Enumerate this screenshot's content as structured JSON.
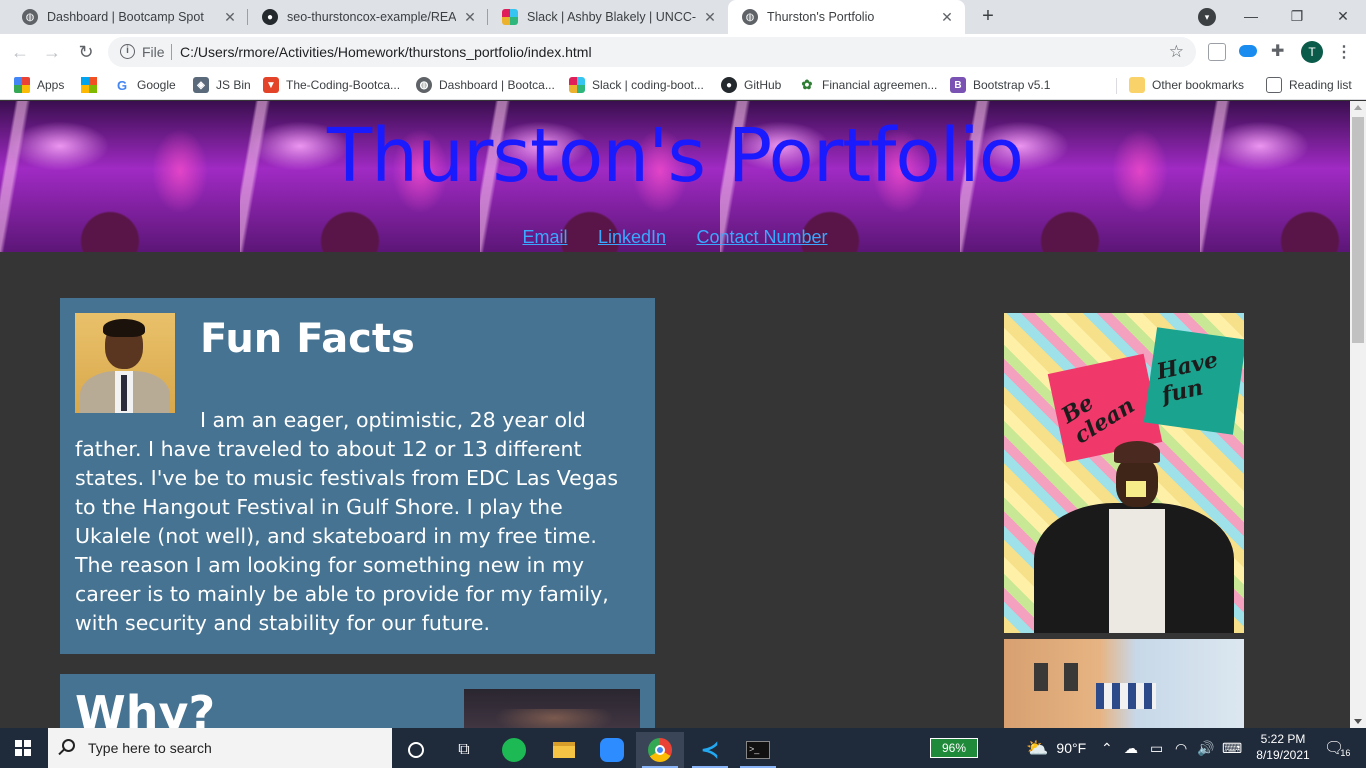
{
  "browser": {
    "tabs": [
      {
        "title": "Dashboard | Bootcamp Spot",
        "icon": "globe-icon",
        "active": false
      },
      {
        "title": "seo-thurstoncox-example/READM",
        "icon": "github-icon",
        "active": false
      },
      {
        "title": "Slack | Ashby Blakely | UNCC-VIR",
        "icon": "slack-icon",
        "active": false
      },
      {
        "title": "Thurston's Portfolio",
        "icon": "globe-icon",
        "active": true
      }
    ],
    "new_tab_label": "+",
    "omnibox": {
      "scheme_label": "File",
      "url": "C:/Users/rmore/Activities/Homework/thurstons_portfolio/index.html"
    },
    "profile_initial": "T",
    "bookmarks": [
      {
        "label": "Apps",
        "icon": "apps-grid-icon"
      },
      {
        "label": "",
        "icon": "microsoft-icon"
      },
      {
        "label": "Google",
        "icon": "google-icon"
      },
      {
        "label": "JS Bin",
        "icon": "jsbin-icon"
      },
      {
        "label": "The-Coding-Bootca...",
        "icon": "gitlab-icon"
      },
      {
        "label": "Dashboard | Bootca...",
        "icon": "globe-icon"
      },
      {
        "label": "Slack | coding-boot...",
        "icon": "slack-icon"
      },
      {
        "label": "GitHub",
        "icon": "github-icon"
      },
      {
        "label": "Financial agreemen...",
        "icon": "leaf-icon"
      },
      {
        "label": "Bootstrap v5.1",
        "icon": "bootstrap-icon"
      }
    ],
    "other_bookmarks": "Other bookmarks",
    "reading_list": "Reading list"
  },
  "page": {
    "title": "Thurston's Portfolio",
    "nav": [
      "Email",
      "LinkedIn",
      "Contact Number"
    ],
    "fun_facts": {
      "heading": "Fun Facts",
      "body": "I am an eager, optimistic, 28 year old father. I have traveled to about 12 or 13 different states. I've be to music festivals from EDC Las Vegas to the Hangout Festival in Gulf Shore. I play the Ukalele (not well), and skateboard in my free time. The reason I am looking for something new in my career is to mainly be able to provide for my family, with security and stability for our future."
    },
    "why": {
      "heading": "Why?"
    },
    "photo_signs": [
      "Be clean",
      "Have fun"
    ]
  },
  "taskbar": {
    "search_placeholder": "Type here to search",
    "battery": "96%",
    "weather": "90°F",
    "time": "5:22 PM",
    "date": "8/19/2021",
    "notifications": "16"
  },
  "colors": {
    "page_bg": "#353535",
    "card_bg": "#467391",
    "title_blue": "#1a1aff",
    "link_blue": "#3aa8ff"
  }
}
